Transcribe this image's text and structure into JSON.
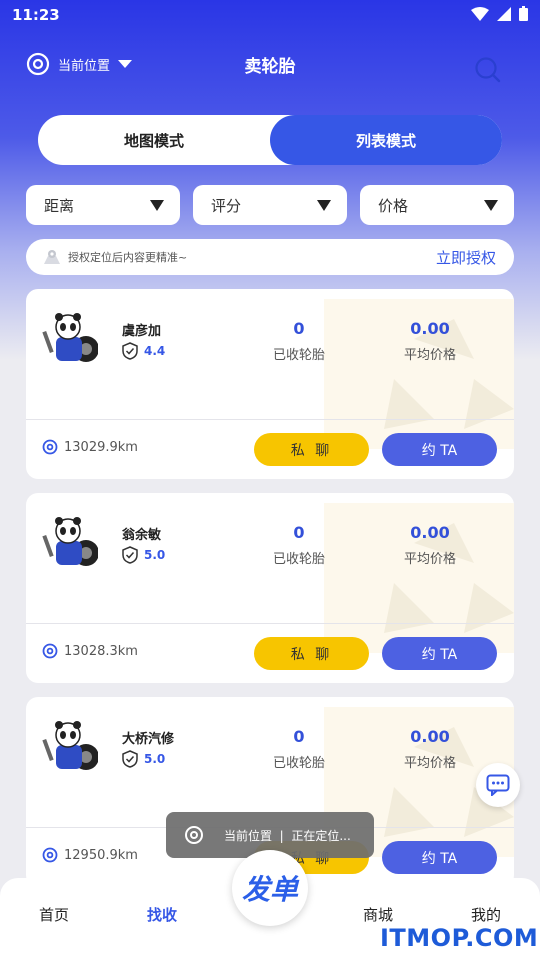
{
  "status": {
    "time": "11:23"
  },
  "header": {
    "location_label": "当前位置",
    "title": "卖轮胎",
    "icons": {
      "location": "location-icon",
      "dropdown": "caret-down-icon",
      "search": "search-icon"
    }
  },
  "mode_toggle": {
    "map": "地图模式",
    "list": "列表模式",
    "active": "list"
  },
  "filters": [
    {
      "label": "距离"
    },
    {
      "label": "评分"
    },
    {
      "label": "价格"
    }
  ],
  "auth_banner": {
    "text": "授权定位后内容更精准~",
    "link": "立即授权"
  },
  "cards": [
    {
      "name": "虞彦加",
      "rating": "4.4",
      "collected_value": "0",
      "collected_label": "已收轮胎",
      "avg_price_value": "0.00",
      "avg_price_label": "平均价格",
      "distance": "13029.9km",
      "chat_label": "私 聊",
      "date_label": "约 TA"
    },
    {
      "name": "翁余敏",
      "rating": "5.0",
      "collected_value": "0",
      "collected_label": "已收轮胎",
      "avg_price_value": "0.00",
      "avg_price_label": "平均价格",
      "distance": "13028.3km",
      "chat_label": "私 聊",
      "date_label": "约 TA"
    },
    {
      "name": "大桥汽修",
      "rating": "5.0",
      "collected_value": "0",
      "collected_label": "已收轮胎",
      "avg_price_value": "0.00",
      "avg_price_label": "平均价格",
      "distance": "12950.9km",
      "chat_label": "私 聊",
      "date_label": "约 TA"
    }
  ],
  "toast": {
    "location_label": "当前位置",
    "separator": "|",
    "status": "正在定位..."
  },
  "tabbar": {
    "items": [
      {
        "label": "首页",
        "active": false
      },
      {
        "label": "找收",
        "active": true
      },
      {
        "label": "商城",
        "active": false
      },
      {
        "label": "我的",
        "active": false
      }
    ],
    "fab_label": "发单"
  },
  "watermark": "ITMOP.COM",
  "colors": {
    "primary": "#3657e6",
    "accent_yellow": "#f7c500",
    "header_gradient_top": "#2a36e6"
  }
}
